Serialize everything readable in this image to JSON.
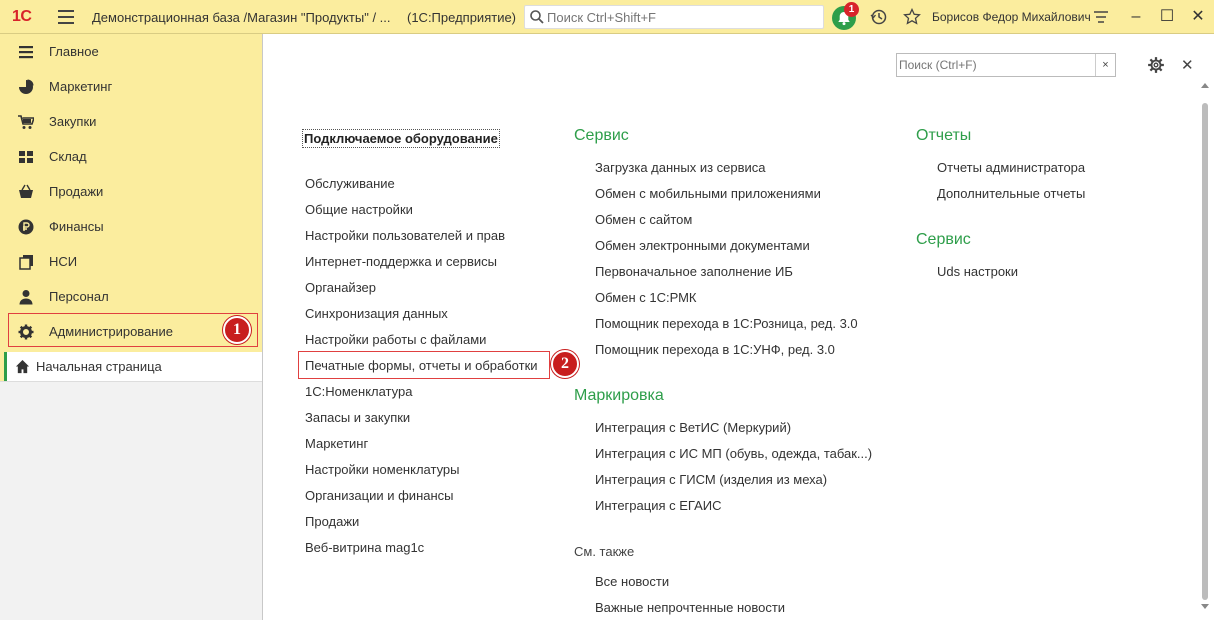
{
  "titlebar": {
    "logo": "1С",
    "title": "Демонстрационная база /Магазин \"Продукты\" / ...",
    "app": "(1С:Предприятие)",
    "search_placeholder": "Поиск Ctrl+Shift+F",
    "notifications_count": "1",
    "user": "Борисов Федор Михайлович"
  },
  "sidebar": {
    "items": [
      {
        "label": "Главное",
        "icon": "menu-lines-icon"
      },
      {
        "label": "Маркетинг",
        "icon": "pie-chart-icon"
      },
      {
        "label": "Закупки",
        "icon": "cart-icon"
      },
      {
        "label": "Склад",
        "icon": "warehouse-icon"
      },
      {
        "label": "Продажи",
        "icon": "basket-icon"
      },
      {
        "label": "Финансы",
        "icon": "ruble-icon"
      },
      {
        "label": "НСИ",
        "icon": "books-icon"
      },
      {
        "label": "Персонал",
        "icon": "person-icon"
      },
      {
        "label": "Администрирование",
        "icon": "gear-icon"
      }
    ],
    "home": "Начальная страница"
  },
  "content": {
    "search_placeholder": "Поиск (Ctrl+F)",
    "clear": "×",
    "col1": {
      "head": "Подключаемое оборудование",
      "links": [
        "Обслуживание",
        "Общие настройки",
        "Настройки пользователей и прав",
        "Интернет-поддержка и сервисы",
        "Органайзер",
        "Синхронизация данных",
        "Настройки работы с файлами",
        "Печатные формы, отчеты и обработки",
        "1С:Номенклатура",
        "Запасы и закупки",
        "Маркетинг",
        "Настройки номенклатуры",
        "Организации и финансы",
        "Продажи",
        "Веб-витрина mag1c"
      ]
    },
    "col2": {
      "service_head": "Сервис",
      "service_links": [
        "Загрузка данных из сервиса",
        "Обмен с мобильными приложениями",
        "Обмен с сайтом",
        "Обмен электронными документами",
        "Первоначальное заполнение ИБ",
        "Обмен с 1С:РМК",
        "Помощник перехода в 1С:Розница, ред. 3.0",
        "Помощник перехода в 1С:УНФ, ред. 3.0"
      ],
      "marking_head": "Маркировка",
      "marking_links": [
        "Интеграция с ВетИС (Меркурий)",
        "Интеграция с ИС МП (обувь, одежда, табак...)",
        "Интеграция с ГИСМ (изделия из меха)",
        "Интеграция с ЕГАИС"
      ],
      "see_also_head": "См. также",
      "see_also_links": [
        "Все новости",
        "Важные непрочтенные новости"
      ]
    },
    "col3": {
      "reports_head": "Отчеты",
      "reports_links": [
        "Отчеты администратора",
        "Дополнительные отчеты"
      ],
      "service_head": "Сервис",
      "service_links": [
        "Uds настроки"
      ]
    }
  },
  "markers": {
    "first": "1",
    "second": "2"
  },
  "colors": {
    "accent_green": "#2e9e4a",
    "sidebar_bg": "#fbed9e",
    "marker_red": "#c81e1e"
  }
}
